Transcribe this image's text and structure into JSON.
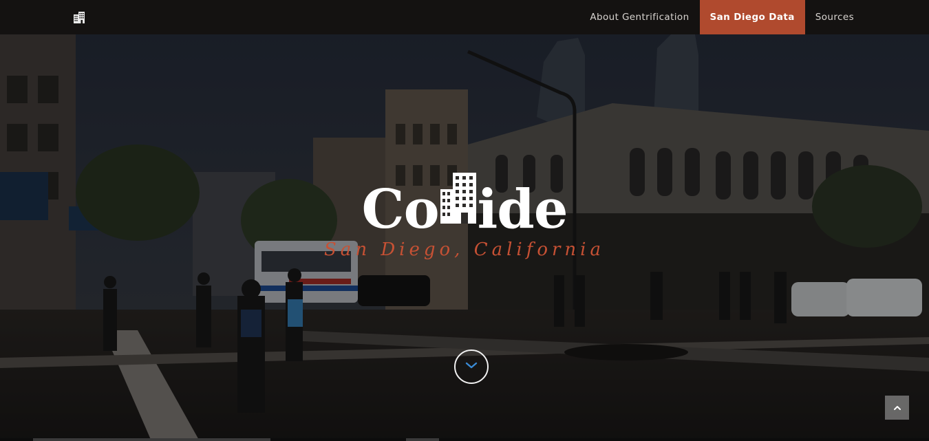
{
  "navbar": {
    "brand_icon": "building-icon",
    "items": [
      {
        "label": "About Gentrification",
        "active": false
      },
      {
        "label": "San Diego Data",
        "active": true
      },
      {
        "label": "Sources",
        "active": false
      }
    ]
  },
  "hero": {
    "logo": {
      "prefix": "Co",
      "icon": "building-icon",
      "suffix": "ide"
    },
    "tagline": "San Diego, California",
    "scroll_icon": "chevron-down-icon",
    "back_to_top_icon": "chevron-up-icon"
  },
  "colors": {
    "navbar_bg": "#141211",
    "accent": "#b04a2e",
    "tagline": "#c75134",
    "scroll_chevron": "#3a8bd6"
  }
}
